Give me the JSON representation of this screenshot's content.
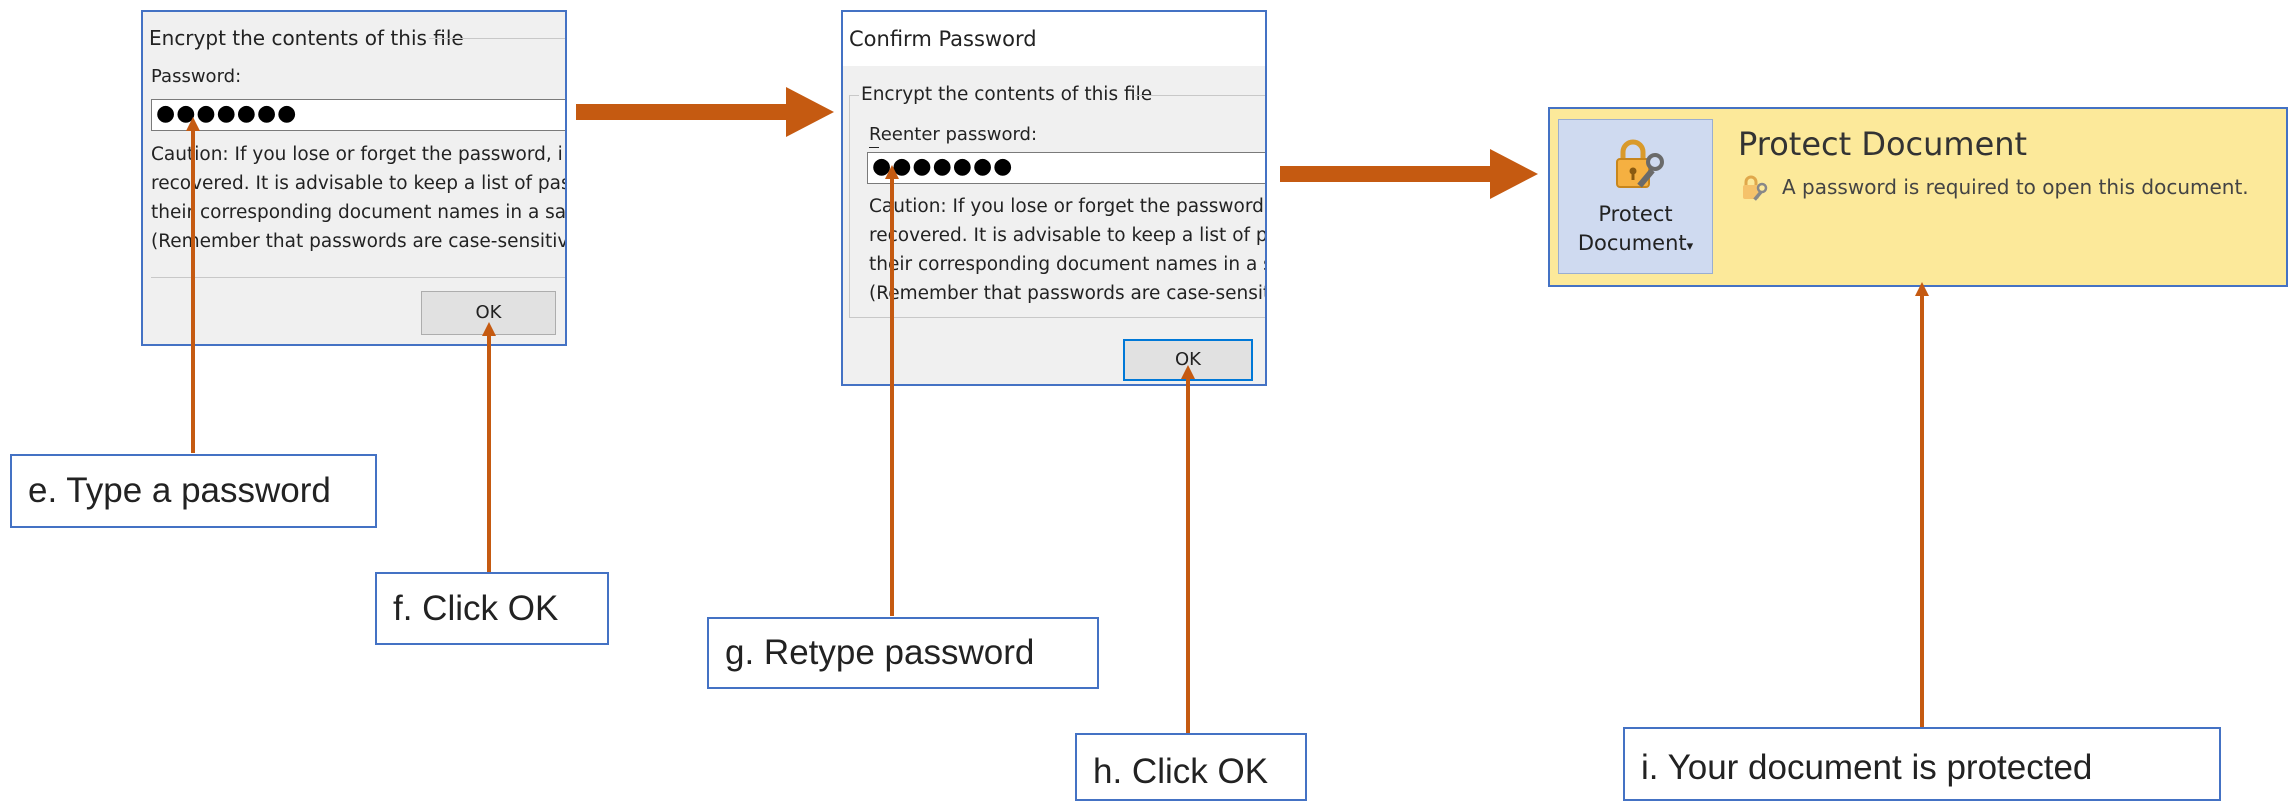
{
  "dialog1": {
    "group_title": "Encrypt the contents of this file",
    "field_label": "Password:",
    "password_value": "●●●●●●●",
    "caution_lines": [
      "Caution: If you lose or forget the password, i",
      "recovered. It is advisable to keep a list of pas",
      "their corresponding document names in a sa",
      "(Remember that passwords are case-sensitive"
    ],
    "ok_label": "OK"
  },
  "dialog2": {
    "window_title": "Confirm Password",
    "group_title": "Encrypt the contents of this file",
    "field_label": "Reenter password:",
    "password_value": "●●●●●●●",
    "caution_lines": [
      "Caution: If you lose or forget the password, it",
      "recovered. It is advisable to keep a list of pas",
      "their corresponding document names in a sa",
      "(Remember that passwords are case-sensitive"
    ],
    "ok_label": "OK"
  },
  "protect": {
    "button_line1": "Protect",
    "button_line2": "Document",
    "dropdown_glyph": "▾",
    "title": "Protect Document",
    "message": "A password is required to open this document.",
    "icons": [
      "lock-key-icon",
      "small-lock-icon"
    ]
  },
  "callouts": {
    "e": "e. Type a password",
    "f": "f. Click OK",
    "g": "g. Retype password",
    "h": "h. Click OK",
    "i": "i. Your document is protected"
  },
  "colors": {
    "arrow": "#c55a11",
    "border": "#4472c4",
    "protect_bg": "#fce99a",
    "dialog_bg": "#f0f0f0"
  }
}
